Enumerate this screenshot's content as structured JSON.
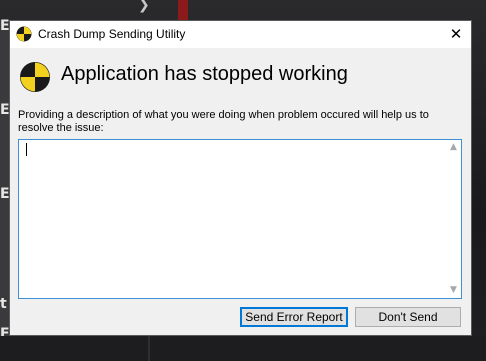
{
  "window": {
    "title": "Crash Dump Sending Utility",
    "close_glyph": "✕"
  },
  "header": {
    "title": "Application has stopped working",
    "icon": "warning-hazard-icon"
  },
  "description": {
    "label": "Providing a description of what you were doing when problem occured will help us to resolve the issue:",
    "value": ""
  },
  "buttons": {
    "send": "Send Error Report",
    "dont_send": "Don't Send"
  },
  "background": {
    "left_letters": [
      "E",
      "E",
      "E",
      "t",
      "E"
    ]
  },
  "colors": {
    "dialog_bg": "#f0f0f0",
    "focus_border": "#3d8fd6",
    "default_button_border": "#0078d7",
    "hazard_yellow": "#f2d21e",
    "hazard_black": "#1a1a1a"
  }
}
